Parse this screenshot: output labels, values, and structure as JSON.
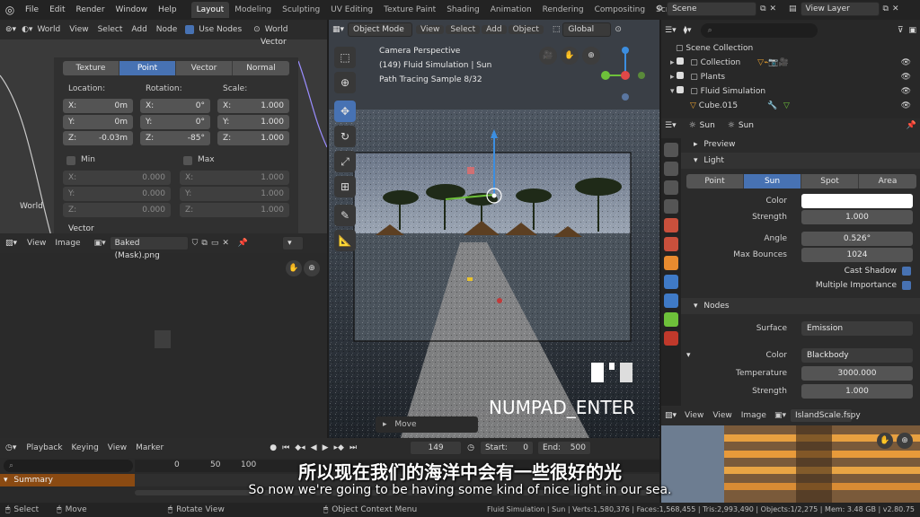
{
  "topbar": {
    "menus": [
      "File",
      "Edit",
      "Render",
      "Window",
      "Help"
    ],
    "tabs": [
      "Layout",
      "Modeling",
      "Sculpting",
      "UV Editing",
      "Texture Paint",
      "Shading",
      "Animation",
      "Rendering",
      "Compositing",
      "Scripting"
    ],
    "active_tab": "Layout",
    "scene": "Scene",
    "view_layer": "View Layer"
  },
  "node_editor": {
    "world_dropdown": "World",
    "menus": [
      "View",
      "Select",
      "Add",
      "Node"
    ],
    "use_nodes": "Use Nodes",
    "world_right": "World",
    "vector_top": "Vector",
    "vector_bottom": "Vector",
    "world_label": "World",
    "mapping_types": [
      "Texture",
      "Point",
      "Vector",
      "Normal"
    ],
    "active_type": "Point",
    "location_label": "Location:",
    "rotation_label": "Rotation:",
    "scale_label": "Scale:",
    "location": [
      {
        "axis": "X:",
        "value": "0m"
      },
      {
        "axis": "Y:",
        "value": "0m"
      },
      {
        "axis": "Z:",
        "value": "-0.03m"
      }
    ],
    "rotation": [
      {
        "axis": "X:",
        "value": "0°"
      },
      {
        "axis": "Y:",
        "value": "0°"
      },
      {
        "axis": "Z:",
        "value": "-85°"
      }
    ],
    "scale": [
      {
        "axis": "X:",
        "value": "1.000"
      },
      {
        "axis": "Y:",
        "value": "1.000"
      },
      {
        "axis": "Z:",
        "value": "1.000"
      }
    ],
    "min_label": "Min",
    "max_label": "Max",
    "min": [
      {
        "axis": "X:",
        "value": "0.000"
      },
      {
        "axis": "Y:",
        "value": "0.000"
      },
      {
        "axis": "Z:",
        "value": "0.000"
      }
    ],
    "max": [
      {
        "axis": "X:",
        "value": "1.000"
      },
      {
        "axis": "Y:",
        "value": "1.000"
      },
      {
        "axis": "Z:",
        "value": "1.000"
      }
    ]
  },
  "image_editor": {
    "menus": [
      "View",
      "Image"
    ],
    "image_name": "Baked (Mask).png"
  },
  "viewport": {
    "mode": "Object Mode",
    "menus": [
      "View",
      "Select",
      "Add",
      "Object"
    ],
    "orientation": "Global",
    "camera_label": "Camera Perspective",
    "scene_info": "(149) Fluid Simulation | Sun",
    "sample_info": "Path Tracing Sample 8/32",
    "operator": "Move",
    "key_hint": "NUMPAD_ENTER"
  },
  "outliner": {
    "search_placeholder": "",
    "rows": [
      {
        "label": "Scene Collection",
        "indent": 0
      },
      {
        "label": "Collection",
        "indent": 1
      },
      {
        "label": "Plants",
        "indent": 1
      },
      {
        "label": "Fluid Simulation",
        "indent": 1
      },
      {
        "label": "Cube.015",
        "indent": 2
      }
    ]
  },
  "properties": {
    "object_name": "Sun",
    "data_name": "Sun",
    "preview_section": "Preview",
    "light_section": "Light",
    "light_types": [
      "Point",
      "Sun",
      "Spot",
      "Area"
    ],
    "active_light_type": "Sun",
    "color_label": "Color",
    "strength_label": "Strength",
    "strength": "1.000",
    "angle_label": "Angle",
    "angle": "0.526°",
    "max_bounces_label": "Max Bounces",
    "max_bounces": "1024",
    "cast_shadow": "Cast Shadow",
    "multiple_importance": "Multiple Importance",
    "nodes_section": "Nodes",
    "surface_label": "Surface",
    "surface": "Emission",
    "color2_label": "Color",
    "color2": "Blackbody",
    "temperature_label": "Temperature",
    "temperature": "3000.000",
    "strength2_label": "Strength",
    "strength2": "1.000"
  },
  "img_viewer": {
    "menus": [
      "View",
      "View",
      "Image"
    ],
    "image_name": "IslandScale.fspy"
  },
  "timeline": {
    "menus": [
      "Playback",
      "Keying",
      "View",
      "Marker"
    ],
    "current_frame": "149",
    "start_label": "Start:",
    "start": "0",
    "end_label": "End:",
    "end": "500",
    "ruler": [
      "0",
      "50",
      "100"
    ],
    "summary": "Summary"
  },
  "status": {
    "left": [
      {
        "label": "Select"
      },
      {
        "label": "Move"
      },
      {
        "label": "Rotate View"
      },
      {
        "label": "Object Context Menu"
      }
    ],
    "stats": "Fluid Simulation | Sun | Verts:1,580,376 | Faces:1,568,455 | Tris:2,993,490 | Objects:1/2,275 | Mem: 3.48 GB | v2.80.75"
  },
  "subtitles": {
    "cn": "所以现在我们的海洋中会有一些很好的光",
    "en": "So now we're going to be having some kind of nice light in our sea."
  },
  "colors": {
    "accent": "#4772b3",
    "active_object": "#e8a030"
  }
}
